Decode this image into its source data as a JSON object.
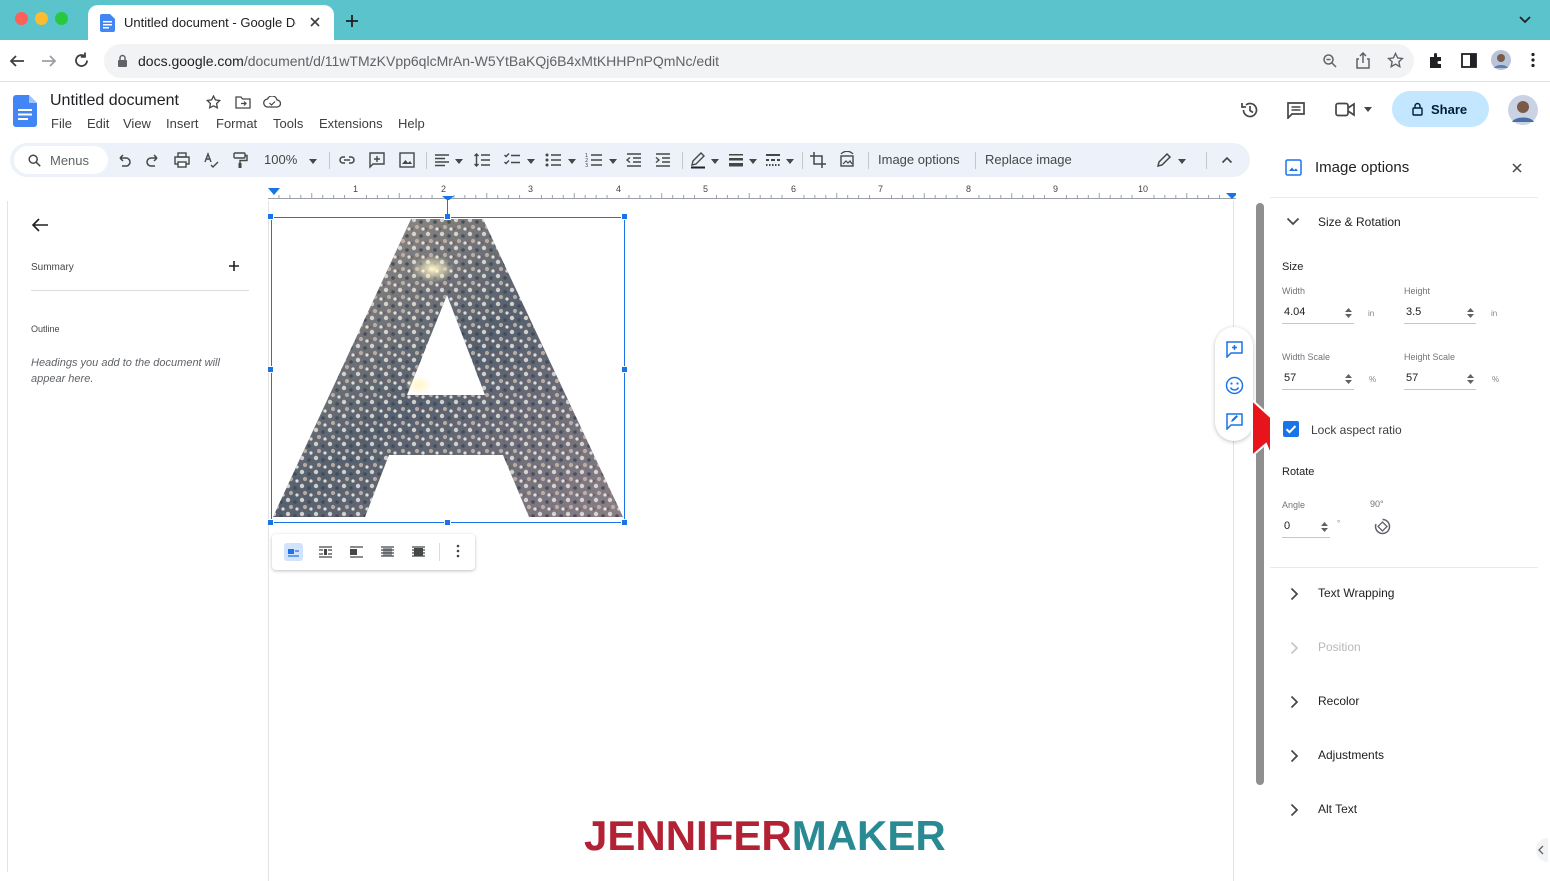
{
  "browser": {
    "tab_title": "Untitled document - Google Docs",
    "url_host": "docs.google.com",
    "url_path": "/document/d/11wTMzKVpp6qlcMrAn-W5YtBaKQj6B4xMtKHHPnPQmNc/edit"
  },
  "doc": {
    "title": "Untitled document",
    "menus": [
      "File",
      "Edit",
      "View",
      "Insert",
      "Format",
      "Tools",
      "Extensions",
      "Help"
    ],
    "share_label": "Share"
  },
  "toolbar": {
    "search_label": "Menus",
    "zoom": "100%",
    "image_options_label": "Image options",
    "replace_image_label": "Replace image"
  },
  "ruler": {
    "numbers": [
      "1",
      "2",
      "3",
      "4",
      "5",
      "6",
      "7",
      "8",
      "9",
      "10"
    ]
  },
  "outline_panel": {
    "summary_label": "Summary",
    "outline_label": "Outline",
    "hint": "Headings you add to the document will appear here."
  },
  "image_options": {
    "title": "Image options",
    "size_rotation": "Size & Rotation",
    "size_label": "Size",
    "width_label": "Width",
    "width_value": "4.04",
    "width_unit": "in",
    "height_label": "Height",
    "height_value": "3.5",
    "height_unit": "in",
    "width_scale_label": "Width Scale",
    "width_scale_value": "57",
    "height_scale_label": "Height Scale",
    "height_scale_value": "57",
    "percent_unit": "%",
    "lock_label": "Lock aspect ratio",
    "lock_checked": true,
    "rotate_label": "Rotate",
    "angle_label": "Angle",
    "angle_value": "0",
    "degree_unit": "°",
    "rotate90_label": "90°",
    "sections": [
      "Text Wrapping",
      "Position",
      "Recolor",
      "Adjustments",
      "Alt Text"
    ]
  },
  "watermark": {
    "part1": "JENNIFER",
    "part2": "MAKER"
  },
  "colors": {
    "chrome_tabbar": "#5bc3cc",
    "accent": "#1a73e8",
    "share_bg": "#c2e7ff",
    "watermark_red": "#b22234",
    "watermark_teal": "#2a8a93"
  }
}
